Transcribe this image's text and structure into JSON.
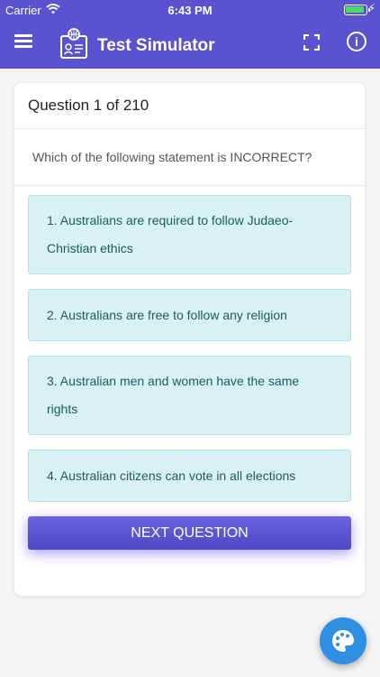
{
  "status_bar": {
    "carrier": "Carrier",
    "time": "6:43 PM"
  },
  "header": {
    "title": "Test Simulator"
  },
  "icons": [
    "wifi-icon",
    "battery-icon",
    "menu-icon",
    "app-logo-icon",
    "fullscreen-icon",
    "info-icon",
    "palette-icon"
  ],
  "quiz": {
    "counter": "Question 1 of 210",
    "question": "Which of the following statement is INCORRECT?",
    "options": [
      "1. Australians are required to follow Judaeo-Christian ethics",
      "2. Australians are free to follow any religion",
      "3. Australian men and women have the same rights",
      "4. Australian citizens can vote in all elections"
    ],
    "next_label": "NEXT QUESTION"
  },
  "colors": {
    "header": "#5a52cf",
    "option_bg": "#d8f2f3",
    "option_text": "#1c5b5e",
    "fab": "#2f8fe3"
  }
}
